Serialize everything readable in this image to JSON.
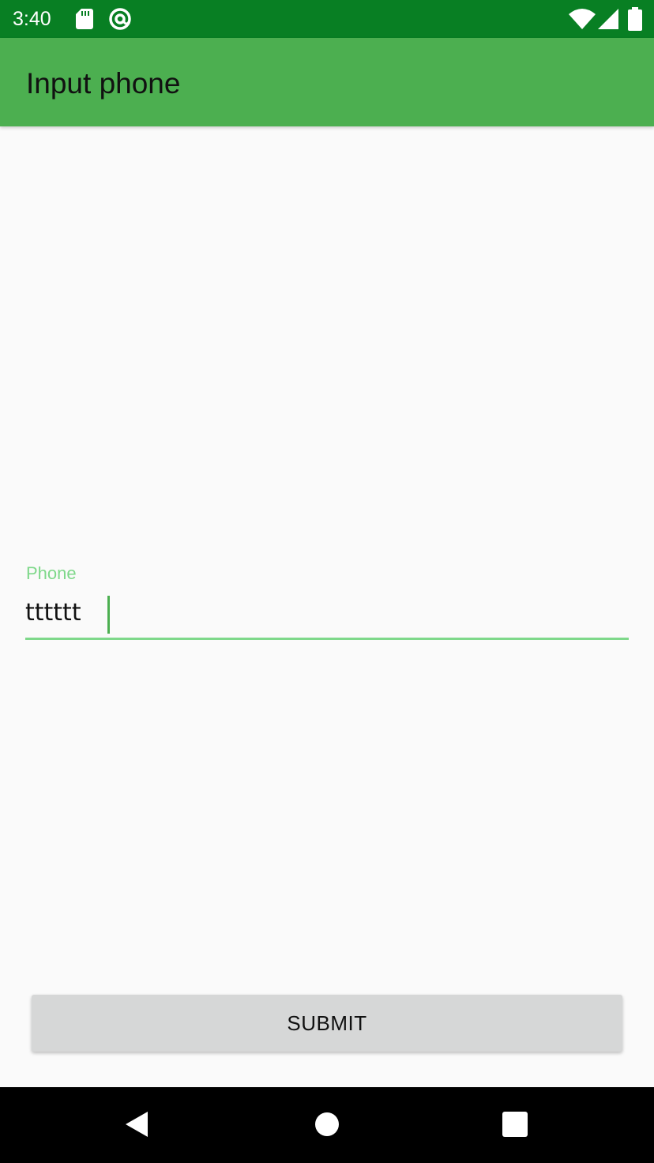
{
  "status_bar": {
    "time": "3:40",
    "left_icons": [
      "sd-card-icon",
      "at-sign-icon"
    ],
    "right_icons": [
      "wifi-icon",
      "cell-signal-icon",
      "battery-icon"
    ]
  },
  "app_bar": {
    "title": "Input phone",
    "color": "#4caf50"
  },
  "form": {
    "phone_label": "Phone",
    "phone_value": "tttttt",
    "accent_color": "#7ed88a",
    "submit_label": "SUBMIT"
  },
  "nav_bar": {
    "icons": [
      "back-icon",
      "home-icon",
      "recents-icon"
    ]
  },
  "colors": {
    "status_bar": "#087f23",
    "background": "#fafafa",
    "button": "#d6d7d7"
  }
}
